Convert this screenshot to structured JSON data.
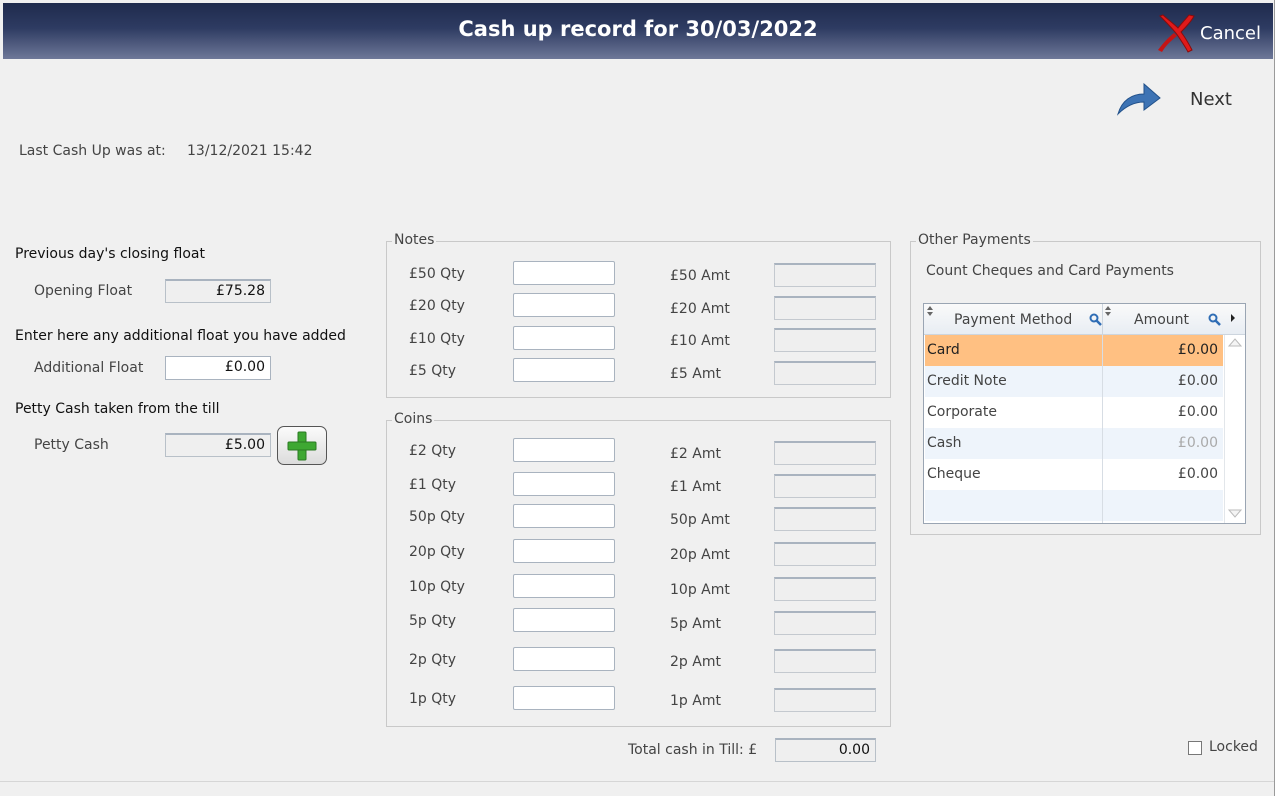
{
  "window": {
    "title": "Cash up record for 30/03/2022",
    "cancel_label": "Cancel",
    "next_label": "Next"
  },
  "last_cash_up": {
    "label": "Last Cash Up was at:",
    "value": "13/12/2021 15:42"
  },
  "float": {
    "previous_heading": "Previous day's closing float",
    "opening_label": "Opening Float",
    "opening_value": "£75.28",
    "additional_heading": "Enter here any additional float you have added",
    "additional_label": "Additional Float",
    "additional_value": "£0.00",
    "petty_heading": "Petty Cash taken from the till",
    "petty_label": "Petty Cash",
    "petty_value": "£5.00"
  },
  "notes": {
    "legend": "Notes",
    "rows": [
      {
        "qty_label": "£50 Qty",
        "amt_label": "£50 Amt",
        "qty": "",
        "amt": ""
      },
      {
        "qty_label": "£20 Qty",
        "amt_label": "£20 Amt",
        "qty": "",
        "amt": ""
      },
      {
        "qty_label": "£10 Qty",
        "amt_label": "£10 Amt",
        "qty": "",
        "amt": ""
      },
      {
        "qty_label": "£5 Qty",
        "amt_label": "£5 Amt",
        "qty": "",
        "amt": ""
      }
    ]
  },
  "coins": {
    "legend": "Coins",
    "rows": [
      {
        "qty_label": "£2 Qty",
        "amt_label": "£2 Amt",
        "qty": "",
        "amt": ""
      },
      {
        "qty_label": "£1 Qty",
        "amt_label": "£1 Amt",
        "qty": "",
        "amt": ""
      },
      {
        "qty_label": "50p Qty",
        "amt_label": "50p Amt",
        "qty": "",
        "amt": ""
      },
      {
        "qty_label": "20p Qty",
        "amt_label": "20p Amt",
        "qty": "",
        "amt": ""
      },
      {
        "qty_label": "10p Qty",
        "amt_label": "10p Amt",
        "qty": "",
        "amt": ""
      },
      {
        "qty_label": "5p Qty",
        "amt_label": "5p Amt",
        "qty": "",
        "amt": ""
      },
      {
        "qty_label": "2p Qty",
        "amt_label": "2p Amt",
        "qty": "",
        "amt": ""
      },
      {
        "qty_label": "1p Qty",
        "amt_label": "1p Amt",
        "qty": "",
        "amt": ""
      }
    ]
  },
  "total": {
    "label": "Total cash in Till: £",
    "value": "0.00"
  },
  "other_payments": {
    "legend": "Other Payments",
    "subtitle": "Count Cheques and Card Payments",
    "columns": [
      "Payment Method",
      "Amount"
    ],
    "rows": [
      {
        "method": "Card",
        "amount": "£0.00"
      },
      {
        "method": "Credit Note",
        "amount": "£0.00"
      },
      {
        "method": "Corporate",
        "amount": "£0.00"
      },
      {
        "method": "Cash",
        "amount": "£0.00"
      },
      {
        "method": "Cheque",
        "amount": "£0.00"
      }
    ]
  },
  "locked_label": "Locked",
  "colors": {
    "title_bar": "#2e3b62",
    "selected_row": "#ffc082",
    "alt_row": "#eef4fb",
    "plus_green": "#3ea832",
    "cancel_red": "#e01a1a",
    "next_blue": "#3d73b4"
  }
}
